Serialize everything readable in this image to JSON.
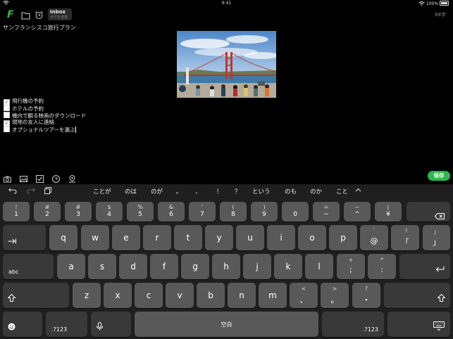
{
  "status_bar": {
    "time": "9:41",
    "battery": "100%"
  },
  "toolbar": {
    "inbox_label": "Inbox",
    "inbox_sub": "タグを追加",
    "char_count": "68字"
  },
  "note": {
    "title": "サンフランシスコ旅行プラン",
    "checklist": [
      {
        "text": "飛行機の予約",
        "checked": true
      },
      {
        "text": "ホテルの予約",
        "checked": false
      },
      {
        "text": "機内で観る映画のダウンロード",
        "checked": false
      },
      {
        "text": "現地の友人に連絡",
        "checked": true
      },
      {
        "text": "オプショナルツアーを選ぶ",
        "checked": false
      }
    ]
  },
  "save_label": "保存",
  "keyboard": {
    "candidates": [
      "ことが",
      "のは",
      "のが",
      "。",
      "、",
      "！",
      "？",
      "という",
      "のも",
      "のか",
      "こと"
    ],
    "row1": [
      {
        "top": "!",
        "main": "1"
      },
      {
        "top": "#",
        "main": "2"
      },
      {
        "top": "#",
        "main": "3"
      },
      {
        "top": "$",
        "main": "4"
      },
      {
        "top": "%",
        "main": "5"
      },
      {
        "top": "&",
        "main": "6"
      },
      {
        "top": "'",
        "main": "7"
      },
      {
        "top": "(",
        "main": "8"
      },
      {
        "top": ")",
        "main": "9"
      },
      {
        "top": "",
        "main": "0"
      },
      {
        "top": "=",
        "main": "−"
      },
      {
        "top": "~",
        "main": "^"
      },
      {
        "top": "|",
        "main": "¥"
      }
    ],
    "row2": [
      "q",
      "w",
      "e",
      "r",
      "t",
      "y",
      "u",
      "i",
      "o",
      "p"
    ],
    "row2_extra": [
      {
        "top": "`",
        "main": "@"
      },
      {
        "top": "「",
        "main": "「"
      },
      {
        "top": "」",
        "main": "」"
      }
    ],
    "row3": [
      "a",
      "s",
      "d",
      "f",
      "g",
      "h",
      "j",
      "k",
      "l"
    ],
    "row3_extra": [
      {
        "top": "+",
        "main": ";"
      },
      {
        "top": "*",
        "main": ":"
      }
    ],
    "row4": [
      "z",
      "x",
      "c",
      "v",
      "b",
      "n",
      "m"
    ],
    "row4_extra": [
      {
        "top": "<",
        "main": "、"
      },
      {
        "top": ">",
        "main": "。"
      },
      {
        "top": "?",
        "main": "・"
      }
    ],
    "abc_label": "abc",
    "numbers_label": ".?123",
    "space_label": "空白"
  }
}
